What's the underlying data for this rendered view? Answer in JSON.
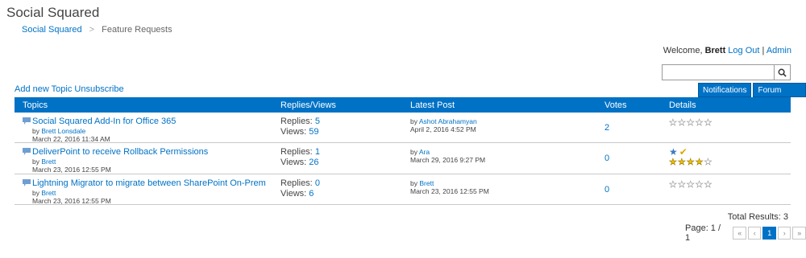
{
  "site": {
    "title": "Social Squared"
  },
  "breadcrumb": {
    "root": "Social Squared",
    "current": "Feature Requests"
  },
  "header": {
    "welcome": "Welcome,",
    "user": "Brett",
    "logout": "Log Out",
    "admin": "Admin"
  },
  "search": {
    "placeholder": "",
    "value": ""
  },
  "actions": {
    "add_topic": "Add new Topic",
    "unsubscribe": "Unsubscribe"
  },
  "tools": {
    "notifications": "Notifications",
    "forum_tools": "Forum Tools ▾"
  },
  "columns": {
    "topics": "Topics",
    "replies_views": "Replies/Views",
    "latest_post": "Latest Post",
    "votes": "Votes",
    "details": "Details"
  },
  "labels": {
    "by": "by",
    "replies": "Replies:",
    "views": "Views:"
  },
  "rows": [
    {
      "title": "Social Squared Add-In for Office 365",
      "author": "Brett Lonsdale",
      "date": "March 22, 2016 11:34 AM",
      "replies": "5",
      "views": "59",
      "latest_author": "Ashot Abrahamyan",
      "latest_date": "April 2, 2016 4:52 PM",
      "votes": "2",
      "rating": 0,
      "featured": false
    },
    {
      "title": "DeliverPoint to receive Rollback Permissions",
      "author": "Brett",
      "date": "March 23, 2016 12:55 PM",
      "replies": "1",
      "views": "26",
      "latest_author": "Ara",
      "latest_date": "March 29, 2016 9:27 PM",
      "votes": "0",
      "rating": 4,
      "featured": true
    },
    {
      "title": "Lightning Migrator to migrate between SharePoint On-Prem",
      "author": "Brett",
      "date": "March 23, 2016 12:55 PM",
      "replies": "0",
      "views": "6",
      "latest_author": "Brett",
      "latest_date": "March 23, 2016 12:55 PM",
      "votes": "0",
      "rating": 0,
      "featured": false
    }
  ],
  "footer": {
    "total_results": "Total Results: 3",
    "page_label": "Page: 1 / 1",
    "first": "«",
    "prev": "‹",
    "current_page": "1",
    "next": "›",
    "last": "»"
  },
  "colors": {
    "accent": "#0072c6",
    "star": "#f0c000",
    "check": "#e0a800"
  }
}
